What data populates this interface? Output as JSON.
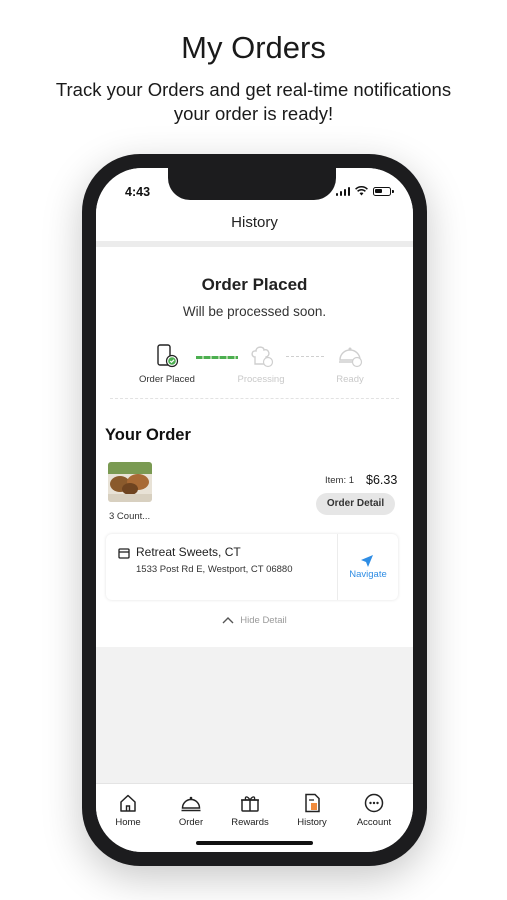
{
  "promo": {
    "title": "My Orders",
    "subtitle": "Track your Orders and get real-time notifications your order is ready!"
  },
  "status_bar": {
    "time": "4:43"
  },
  "nav": {
    "title": "History"
  },
  "order": {
    "title": "Order Placed",
    "subtitle": "Will be processed soon.",
    "steps": [
      {
        "label": "Order Placed",
        "state": "done",
        "icon": "phone-check-icon"
      },
      {
        "label": "Processing",
        "state": "pending",
        "icon": "chef-hat-icon"
      },
      {
        "label": "Ready",
        "state": "pending",
        "icon": "cloche-icon"
      }
    ]
  },
  "your_order": {
    "heading": "Your Order",
    "item_label": "3 Count...",
    "item_count": "Item: 1",
    "price": "$6.33",
    "detail_button": "Order Detail"
  },
  "store": {
    "name": "Retreat Sweets, CT",
    "address": "1533 Post Rd E, Westport, CT 06880",
    "navigate_label": "Navigate"
  },
  "hide_detail": "Hide Detail",
  "tabs": [
    {
      "label": "Home",
      "icon": "home-icon"
    },
    {
      "label": "Order",
      "icon": "cloche-icon"
    },
    {
      "label": "Rewards",
      "icon": "gift-icon"
    },
    {
      "label": "History",
      "icon": "receipt-icon"
    },
    {
      "label": "Account",
      "icon": "more-icon"
    }
  ],
  "colors": {
    "accent_green": "#4caf50",
    "link_blue": "#2f8de4",
    "screen_bg": "#f2f2f2"
  }
}
